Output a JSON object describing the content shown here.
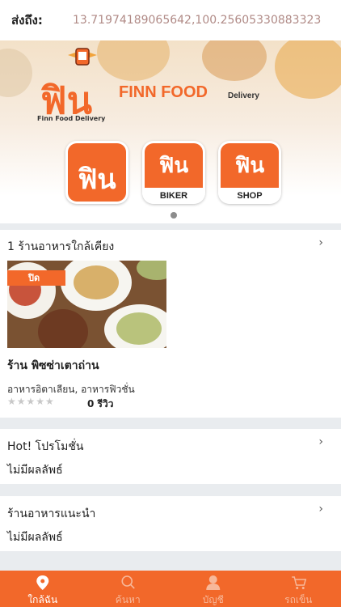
{
  "header": {
    "label": "ส่งถึง:",
    "coordinates": "13.71974189065642,100.25605330883323"
  },
  "banner": {
    "brand_thai": "ฟิน",
    "brand_tagline": "Finn Food Delivery",
    "brand_en": "FINN FOOD",
    "brand_delivery": "Delivery",
    "apps": [
      {
        "thai": "ฟิน",
        "sub": ""
      },
      {
        "thai": "ฟิน",
        "sub": "BIKER"
      },
      {
        "thai": "ฟิน",
        "sub": "SHOP"
      }
    ],
    "app_small_caption": "Finn Food Delivery"
  },
  "nearby": {
    "title": "1 ร้านอาหารใกล้เคียง",
    "restaurant": {
      "status": "ปิด",
      "name": "ร้าน พิซซ่าเตาถ่าน",
      "categories": "อาหารอิตาเลียน, อาหารฟิวชั่น",
      "rating": 0,
      "reviews": "0 รีวิว"
    }
  },
  "promotion": {
    "title": "Hot! โปรโมชั่น",
    "empty": "ไม่มีผลลัพธ์"
  },
  "recommended": {
    "title": "ร้านอาหารแนะนำ",
    "empty": "ไม่มีผลลัพธ์"
  },
  "nav": [
    {
      "label": "ใกล้ฉัน",
      "icon": "location-pin-icon",
      "active": true
    },
    {
      "label": "ค้นหา",
      "icon": "search-icon",
      "active": false
    },
    {
      "label": "บัญชี",
      "icon": "user-icon",
      "active": false
    },
    {
      "label": "รถเข็น",
      "icon": "cart-icon",
      "active": false
    }
  ],
  "colors": {
    "accent": "#f2682a",
    "closed_coords_text": "#b08a86"
  }
}
